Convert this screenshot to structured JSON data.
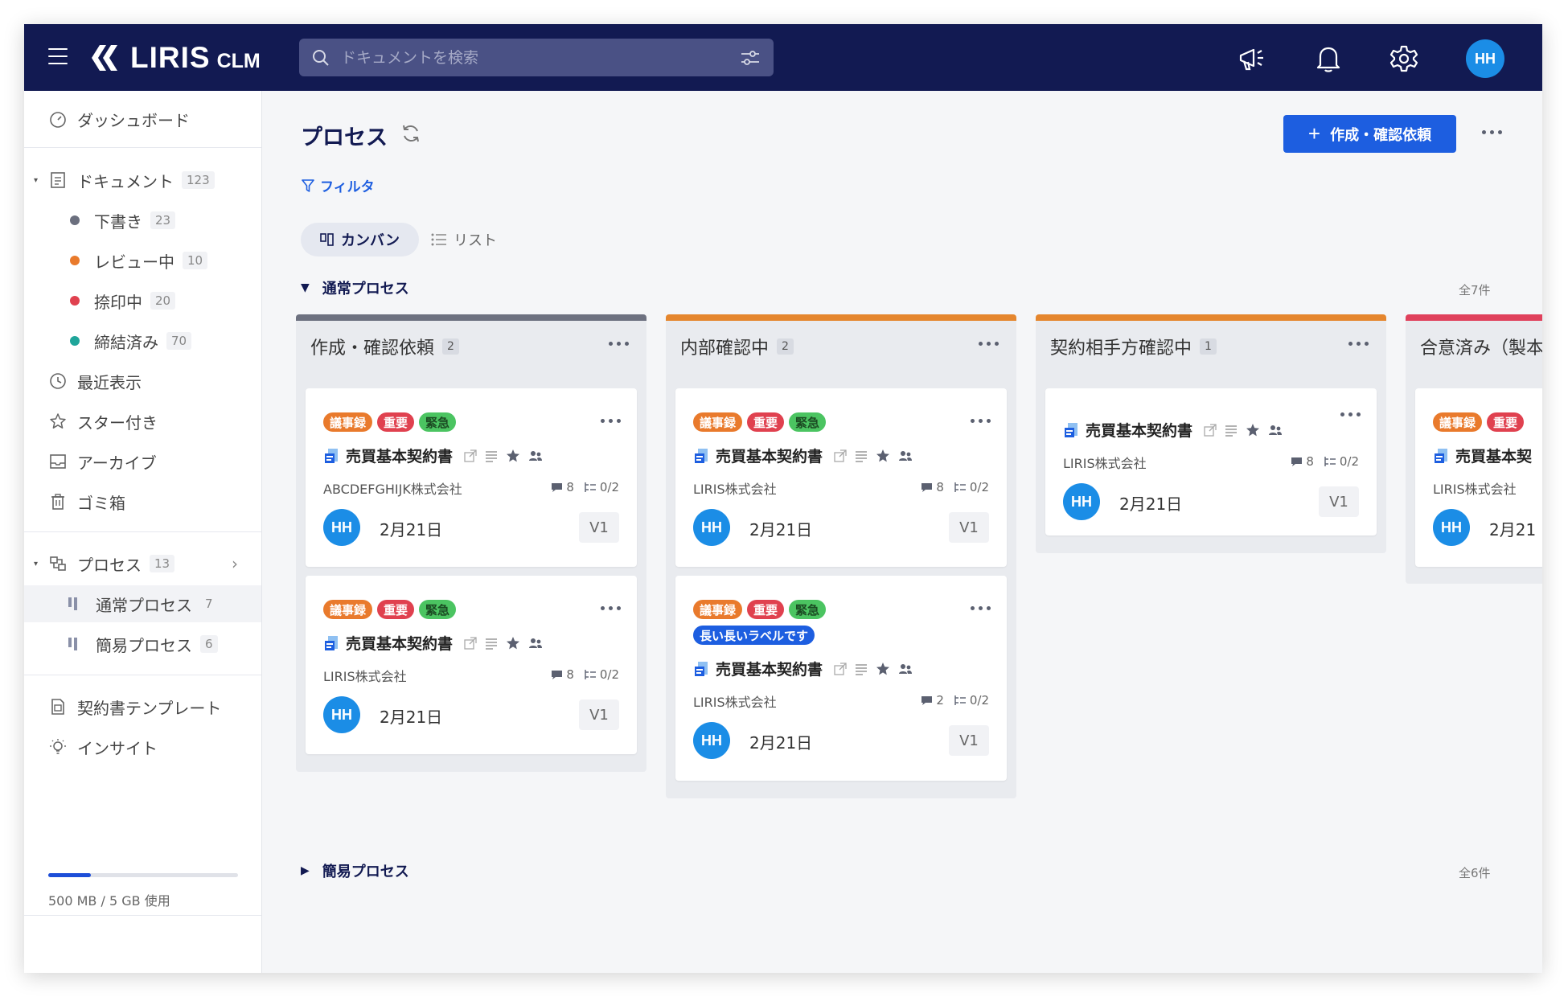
{
  "header": {
    "logo_text": "LIRIS",
    "logo_sub": "CLM",
    "search_placeholder": "ドキュメントを検索",
    "user_initials": "HH"
  },
  "sidebar": {
    "dashboard": "ダッシュボード",
    "documents": {
      "label": "ドキュメント",
      "count": "123"
    },
    "doc_statuses": [
      {
        "label": "下書き",
        "count": "23",
        "color": "#6b6f7e"
      },
      {
        "label": "レビュー中",
        "count": "10",
        "color": "#e97a2c"
      },
      {
        "label": "捺印中",
        "count": "20",
        "color": "#e0414f"
      },
      {
        "label": "締結済み",
        "count": "70",
        "color": "#1fa59a"
      }
    ],
    "recent": "最近表示",
    "starred": "スター付き",
    "archive": "アーカイブ",
    "trash": "ゴミ箱",
    "process": {
      "label": "プロセス",
      "count": "13"
    },
    "process_items": [
      {
        "label": "通常プロセス",
        "count": "7"
      },
      {
        "label": "簡易プロセス",
        "count": "6"
      }
    ],
    "templates": "契約書テンプレート",
    "insight": "インサイト",
    "storage_text": "500 MB / 5 GB 使用",
    "storage_fraction": 0.1
  },
  "main": {
    "title": "プロセス",
    "create_button": "作成・確認依頼",
    "filter": "フィルタ",
    "tabs": {
      "kanban": "カンバン",
      "list": "リスト"
    },
    "sections": [
      {
        "label": "通常プロセス",
        "count": "全7件",
        "expanded": true
      },
      {
        "label": "簡易プロセス",
        "count": "全6件",
        "expanded": false
      }
    ]
  },
  "tag_labels": {
    "minutes": "議事録",
    "important": "重要",
    "urgent": "緊急",
    "long": "長い長いラベルです"
  },
  "doc_title": "売買基本契約書",
  "card_date": "2月21日",
  "card_version": "V1",
  "card_initials": "HH",
  "columns": [
    {
      "title": "作成・確認依頼",
      "count": "2",
      "color": "#6d7180",
      "cards": [
        {
          "company": "ABCDEFGHIJK株式会社",
          "comments": "8",
          "tasks": "0/2"
        },
        {
          "company": "LIRIS株式会社",
          "comments": "8",
          "tasks": "0/2"
        }
      ]
    },
    {
      "title": "内部確認中",
      "count": "2",
      "color": "#e5862e",
      "cards": [
        {
          "company": "LIRIS株式会社",
          "comments": "8",
          "tasks": "0/2"
        },
        {
          "company": "LIRIS株式会社",
          "comments": "2",
          "tasks": "0/2"
        }
      ]
    },
    {
      "title": "契約相手方確認中",
      "count": "1",
      "color": "#e5862e",
      "cards": [
        {
          "company": "LIRIS株式会社",
          "comments": "8",
          "tasks": "0/2"
        }
      ]
    },
    {
      "title": "合意済み（製本",
      "color": "#e0415c",
      "cards": [
        {
          "doc_title_partial": "売買基本契",
          "company": "LIRIS株式会社",
          "date_partial": "2月21"
        }
      ]
    }
  ]
}
